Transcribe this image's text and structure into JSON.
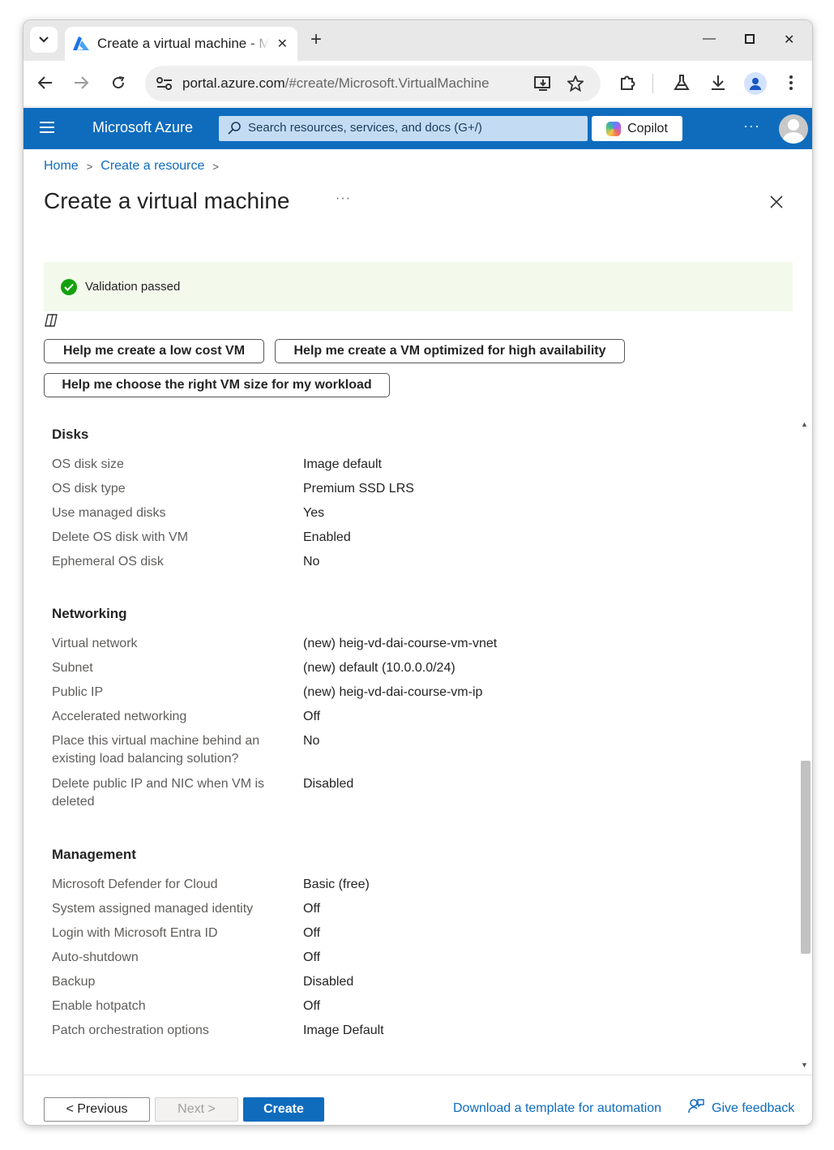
{
  "browser": {
    "tab_title": "Create a virtual machine - Microsoft Azure",
    "url_host": "portal.azure.com",
    "url_path": "/#create/Microsoft.VirtualMachine"
  },
  "azure_header": {
    "brand": "Microsoft Azure",
    "search_placeholder": "Search resources, services, and docs (G+/)",
    "copilot_label": "Copilot",
    "more_label": "···"
  },
  "breadcrumb": [
    "Home",
    "Create a resource"
  ],
  "page": {
    "title": "Create a virtual machine",
    "title_more": "···",
    "validation_text": "Validation passed"
  },
  "suggestions": [
    "Help me create a low cost VM",
    "Help me create a VM optimized for high availability",
    "Help me choose the right VM size for my workload"
  ],
  "sections": {
    "disks": {
      "title": "Disks",
      "rows": [
        {
          "label": "OS disk size",
          "value": "Image default"
        },
        {
          "label": "OS disk type",
          "value": "Premium SSD LRS"
        },
        {
          "label": "Use managed disks",
          "value": "Yes"
        },
        {
          "label": "Delete OS disk with VM",
          "value": "Enabled"
        },
        {
          "label": "Ephemeral OS disk",
          "value": "No"
        }
      ]
    },
    "networking": {
      "title": "Networking",
      "rows": [
        {
          "label": "Virtual network",
          "value": "(new) heig-vd-dai-course-vm-vnet"
        },
        {
          "label": "Subnet",
          "value": "(new) default (10.0.0.0/24)"
        },
        {
          "label": "Public IP",
          "value": "(new) heig-vd-dai-course-vm-ip"
        },
        {
          "label": "Accelerated networking",
          "value": "Off"
        },
        {
          "label": "Place this virtual machine behind an existing load balancing solution?",
          "value": "No"
        },
        {
          "label": "Delete public IP and NIC when VM is deleted",
          "value": "Disabled"
        }
      ]
    },
    "management": {
      "title": "Management",
      "rows": [
        {
          "label": "Microsoft Defender for Cloud",
          "value": "Basic (free)"
        },
        {
          "label": "System assigned managed identity",
          "value": "Off"
        },
        {
          "label": "Login with Microsoft Entra ID",
          "value": "Off"
        },
        {
          "label": "Auto-shutdown",
          "value": "Off"
        },
        {
          "label": "Backup",
          "value": "Disabled"
        },
        {
          "label": "Enable hotpatch",
          "value": "Off"
        },
        {
          "label": "Patch orchestration options",
          "value": "Image Default"
        }
      ]
    }
  },
  "footer": {
    "previous": "< Previous",
    "next": "Next >",
    "create": "Create",
    "download_template": "Download a template for automation",
    "feedback": "Give feedback"
  },
  "colors": {
    "azure_blue": "#0f6cbd",
    "validation_bg": "#f3f9eb",
    "success_green": "#13a10e"
  }
}
